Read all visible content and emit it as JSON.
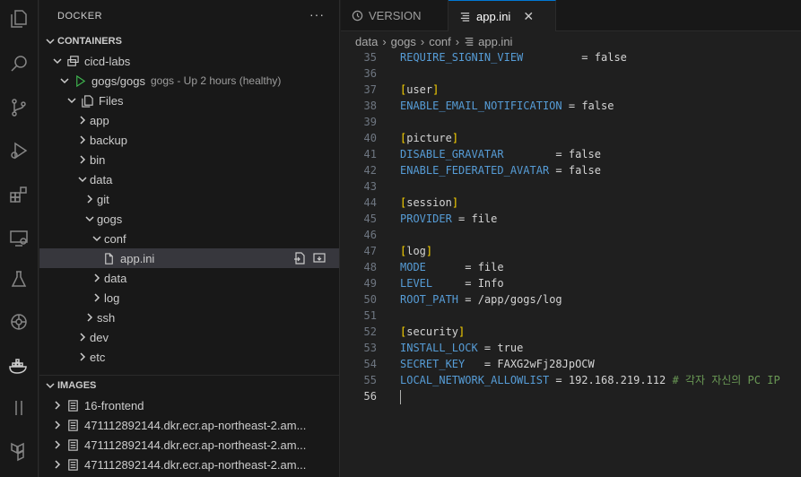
{
  "sidebar": {
    "title": "DOCKER",
    "more": "···",
    "containers": {
      "label": "CONTAINERS",
      "group": "cicd-labs",
      "container": {
        "name": "gogs/gogs",
        "status": "gogs - Up 2 hours (healthy)"
      },
      "files_label": "Files",
      "tree": [
        {
          "label": "app",
          "depth": 0,
          "kind": "folder",
          "open": false
        },
        {
          "label": "backup",
          "depth": 0,
          "kind": "folder",
          "open": false
        },
        {
          "label": "bin",
          "depth": 0,
          "kind": "folder",
          "open": false
        },
        {
          "label": "data",
          "depth": 0,
          "kind": "folder",
          "open": true
        },
        {
          "label": "git",
          "depth": 1,
          "kind": "folder",
          "open": false
        },
        {
          "label": "gogs",
          "depth": 1,
          "kind": "folder",
          "open": true
        },
        {
          "label": "conf",
          "depth": 2,
          "kind": "folder",
          "open": true
        },
        {
          "label": "app.ini",
          "depth": 3,
          "kind": "file",
          "selected": true
        },
        {
          "label": "data",
          "depth": 2,
          "kind": "folder",
          "open": false
        },
        {
          "label": "log",
          "depth": 2,
          "kind": "folder",
          "open": false
        },
        {
          "label": "ssh",
          "depth": 1,
          "kind": "folder",
          "open": false
        },
        {
          "label": "dev",
          "depth": 0,
          "kind": "folder",
          "open": false
        },
        {
          "label": "etc",
          "depth": 0,
          "kind": "folder",
          "open": false
        }
      ]
    },
    "images": {
      "label": "IMAGES",
      "items": [
        "16-frontend",
        "471112892144.dkr.ecr.ap-northeast-2.am...",
        "471112892144.dkr.ecr.ap-northeast-2.am...",
        "471112892144.dkr.ecr.ap-northeast-2.am..."
      ]
    }
  },
  "editor": {
    "tabs": [
      {
        "label": "VERSION",
        "active": false
      },
      {
        "label": "app.ini",
        "active": true,
        "close": "✕"
      }
    ],
    "breadcrumb": [
      "data",
      "gogs",
      "conf",
      "app.ini"
    ],
    "current_line": 56,
    "lines": [
      {
        "n": 35,
        "parts": [
          [
            "key",
            "REQUIRE_SIGNIN_VIEW"
          ],
          [
            "op",
            "         = "
          ],
          [
            "val",
            "false"
          ]
        ]
      },
      {
        "n": 36,
        "parts": []
      },
      {
        "n": 37,
        "parts": [
          [
            "bracket",
            "["
          ],
          [
            "secname",
            "user"
          ],
          [
            "bracket",
            "]"
          ]
        ]
      },
      {
        "n": 38,
        "parts": [
          [
            "key",
            "ENABLE_EMAIL_NOTIFICATION"
          ],
          [
            "op",
            " = "
          ],
          [
            "val",
            "false"
          ]
        ]
      },
      {
        "n": 39,
        "parts": []
      },
      {
        "n": 40,
        "parts": [
          [
            "bracket",
            "["
          ],
          [
            "secname",
            "picture"
          ],
          [
            "bracket",
            "]"
          ]
        ]
      },
      {
        "n": 41,
        "parts": [
          [
            "key",
            "DISABLE_GRAVATAR"
          ],
          [
            "op",
            "        = "
          ],
          [
            "val",
            "false"
          ]
        ]
      },
      {
        "n": 42,
        "parts": [
          [
            "key",
            "ENABLE_FEDERATED_AVATAR"
          ],
          [
            "op",
            " = "
          ],
          [
            "val",
            "false"
          ]
        ]
      },
      {
        "n": 43,
        "parts": []
      },
      {
        "n": 44,
        "parts": [
          [
            "bracket",
            "["
          ],
          [
            "secname",
            "session"
          ],
          [
            "bracket",
            "]"
          ]
        ]
      },
      {
        "n": 45,
        "parts": [
          [
            "key",
            "PROVIDER"
          ],
          [
            "op",
            " = "
          ],
          [
            "val",
            "file"
          ]
        ]
      },
      {
        "n": 46,
        "parts": []
      },
      {
        "n": 47,
        "parts": [
          [
            "bracket",
            "["
          ],
          [
            "secname",
            "log"
          ],
          [
            "bracket",
            "]"
          ]
        ]
      },
      {
        "n": 48,
        "parts": [
          [
            "key",
            "MODE"
          ],
          [
            "op",
            "      = "
          ],
          [
            "val",
            "file"
          ]
        ]
      },
      {
        "n": 49,
        "parts": [
          [
            "key",
            "LEVEL"
          ],
          [
            "op",
            "     = "
          ],
          [
            "val",
            "Info"
          ]
        ]
      },
      {
        "n": 50,
        "parts": [
          [
            "key",
            "ROOT_PATH"
          ],
          [
            "op",
            " = "
          ],
          [
            "val",
            "/app/gogs/log"
          ]
        ]
      },
      {
        "n": 51,
        "parts": []
      },
      {
        "n": 52,
        "parts": [
          [
            "bracket",
            "["
          ],
          [
            "secname",
            "security"
          ],
          [
            "bracket",
            "]"
          ]
        ]
      },
      {
        "n": 53,
        "parts": [
          [
            "key",
            "INSTALL_LOCK"
          ],
          [
            "op",
            " = "
          ],
          [
            "val",
            "true"
          ]
        ]
      },
      {
        "n": 54,
        "parts": [
          [
            "key",
            "SECRET_KEY"
          ],
          [
            "op",
            "   = "
          ],
          [
            "val",
            "FAXG2wFj28JpOCW"
          ]
        ]
      },
      {
        "n": 55,
        "parts": [
          [
            "key",
            "LOCAL_NETWORK_ALLOWLIST"
          ],
          [
            "op",
            " = "
          ],
          [
            "val",
            "192.168.219.112 "
          ],
          [
            "comment",
            "# 각자 자신의 PC IP"
          ]
        ]
      },
      {
        "n": 56,
        "parts": []
      }
    ]
  },
  "colors": {
    "accent": "#0078d4",
    "key": "#569cd6",
    "bracket": "#ffd700",
    "comment": "#6a9955"
  }
}
